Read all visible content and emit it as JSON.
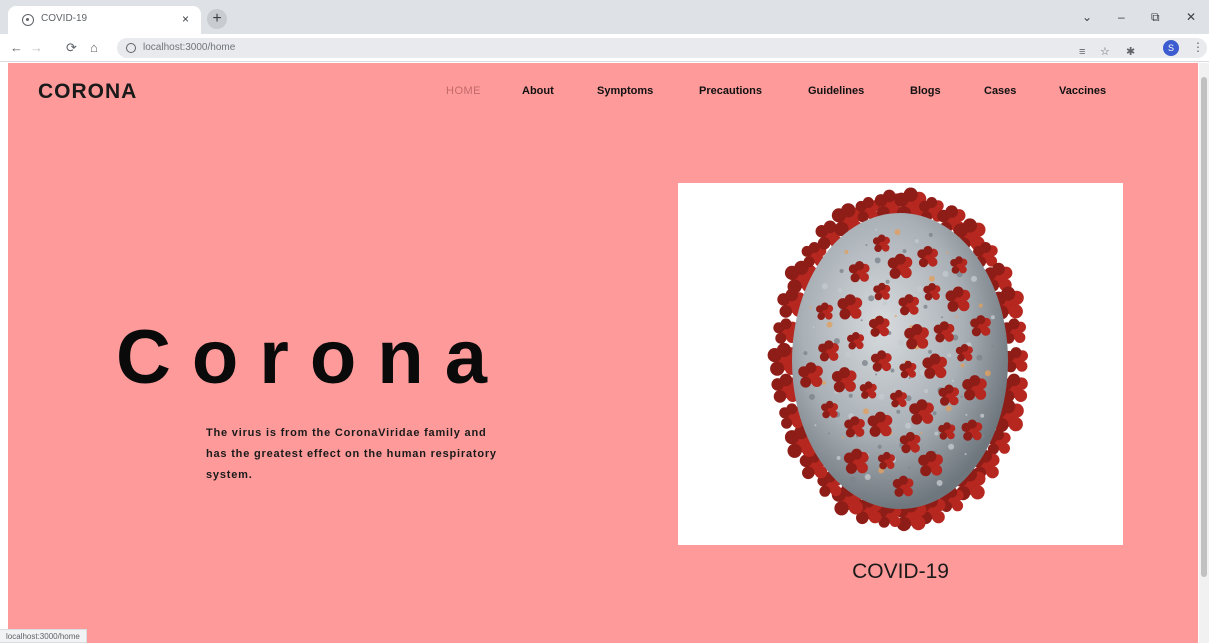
{
  "browser": {
    "tab_title": "COVID-19",
    "tab_close": "×",
    "new_tab": "+",
    "window": {
      "minimize": "–",
      "restore": "⧉",
      "close": "✕",
      "dropdown": "⌄"
    },
    "nav": {
      "back": "←",
      "forward": "→",
      "reload": "⟳",
      "home": "⌂"
    },
    "url": "localhost:3000/home",
    "profile_initial": "S",
    "status_url": "localhost:3000/home"
  },
  "site": {
    "brand": "CORONA",
    "nav": [
      {
        "label": "HOME",
        "active": true
      },
      {
        "label": "About"
      },
      {
        "label": "Symptoms"
      },
      {
        "label": "Precautions"
      },
      {
        "label": "Guidelines"
      },
      {
        "label": "Blogs"
      },
      {
        "label": "Cases"
      },
      {
        "label": "Vaccines"
      }
    ]
  },
  "hero": {
    "title": "Corona",
    "description": "The virus is from the CoronaViridae family and has the greatest effect on the human respiratory system.",
    "image_caption": "COVID-19"
  },
  "colors": {
    "page_bg": "#fe9a9a",
    "nav_active": "#c46a6a",
    "spike": "#b5271f",
    "virus_body": "#a9b0b6"
  }
}
